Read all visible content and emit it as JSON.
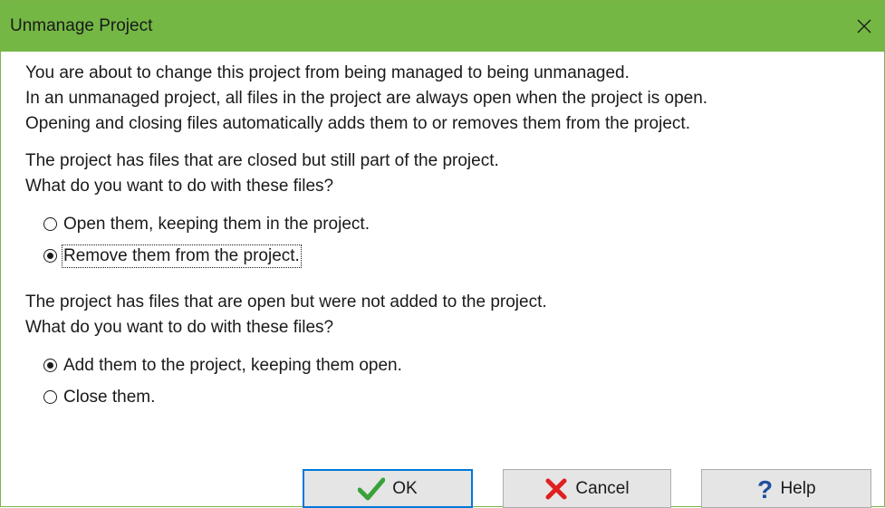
{
  "window": {
    "title": "Unmanage Project"
  },
  "intro": {
    "lines": [
      "You are about to change this project from being managed to being unmanaged.",
      "In an unmanaged project, all files in the project are always open when the project is open.",
      "Opening and closing files automatically adds them to or removes them from the project."
    ]
  },
  "closed_files": {
    "lines": [
      "The project has files that are closed but still part of the project.",
      "What do you want to do with these files?"
    ],
    "options": [
      {
        "label": "Open them, keeping them in the project.",
        "checked": false
      },
      {
        "label": "Remove them from the project.",
        "checked": true
      }
    ]
  },
  "open_files": {
    "lines": [
      "The project has files that are open but were not added to the project.",
      "What do you want to do with these files?"
    ],
    "options": [
      {
        "label": "Add them to the project, keeping them open.",
        "checked": true
      },
      {
        "label": "Close them.",
        "checked": false
      }
    ]
  },
  "buttons": {
    "ok": "OK",
    "cancel": "Cancel",
    "help": "Help"
  },
  "colors": {
    "titlebar": "#74b744",
    "ok_icon": "#3aa13a",
    "cancel_icon": "#e02020",
    "help_icon": "#1e4fa0",
    "default_border": "#0078d7"
  }
}
